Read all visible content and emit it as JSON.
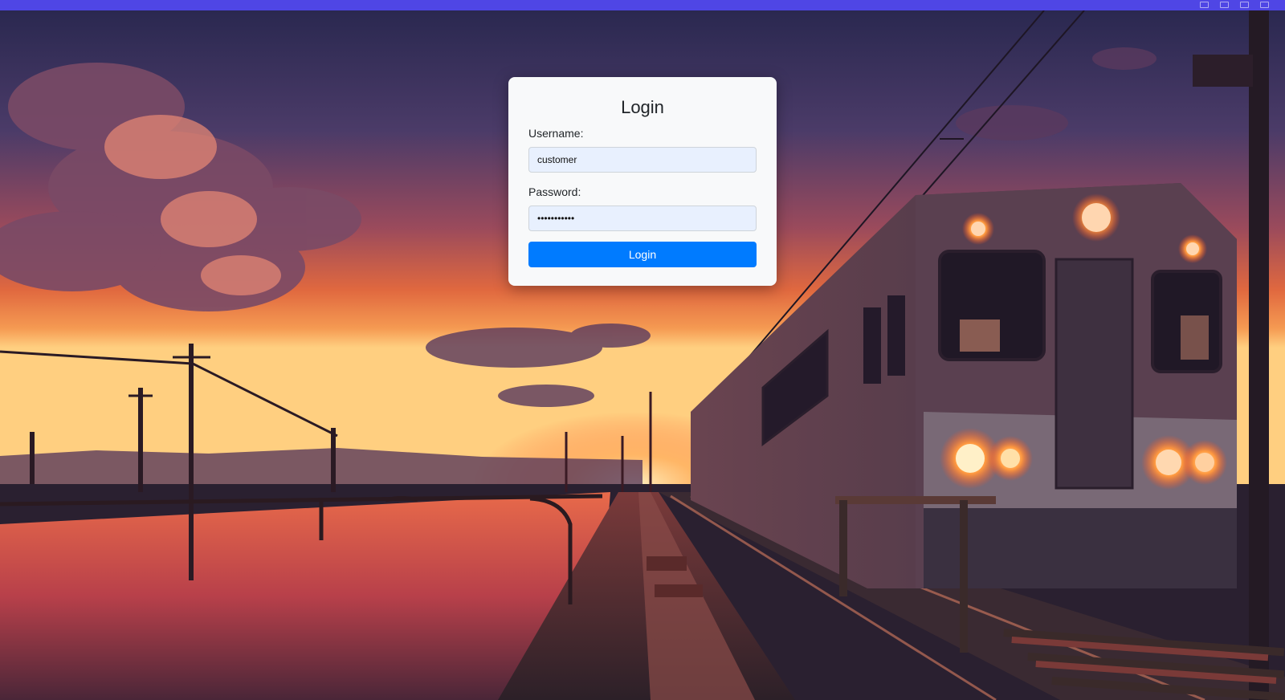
{
  "form": {
    "title": "Login",
    "username_label": "Username:",
    "username_value": "customer",
    "password_label": "Password:",
    "password_value": "•••••••••••",
    "submit_label": "Login"
  },
  "colors": {
    "top_bar": "#4f46e5",
    "card_background": "#f8f9fa",
    "input_background": "#e8f0fe",
    "button_background": "#007bff",
    "button_text": "#ffffff"
  }
}
